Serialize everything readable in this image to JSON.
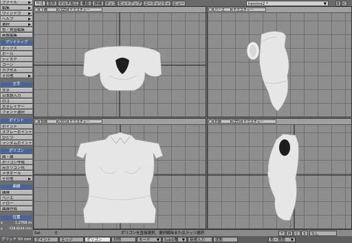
{
  "left_panel": {
    "file": "ファイル",
    "edit": "編集",
    "window": "ウィンドウ",
    "help": "ヘルプ",
    "select": "選択",
    "color_edit": "色・質感編集",
    "image_edit": "画像編集",
    "primitive_header": "プリミティブ",
    "box": "ボックス",
    "ball": "ボール",
    "disc": "ディスク",
    "cone": "コーン",
    "capsule": "カプセル",
    "other1": "その他",
    "text_header": "文字",
    "text": "文字",
    "jp_input": "日本語入力",
    "logo": "ロゴ",
    "text_layer": "文字レイヤー",
    "font_select": "フォント選択",
    "point_header": "ポイント",
    "point": "ポイント",
    "spray_point": "スプレーポイント",
    "bisect": "ひとつ",
    "random_point": "ランダムポイント",
    "polygon_header": "ポリゴン",
    "face": "面・曲",
    "make_polygon": "ポリゴン作成",
    "sketch": "点ポリゴン化",
    "metaball": "メタボール",
    "other2": "その他",
    "curve_header": "曲線",
    "curve": "曲線",
    "bezier": "ベジエ",
    "draw": "ドロー",
    "curve_make": "曲線作成",
    "position_header": "位置",
    "x_label": "x",
    "x_value": "1.2768 m",
    "y_label": "y",
    "y_value": "-158.8244 mm",
    "grid_label": "グリッド",
    "grid_value": "50 mm"
  },
  "top_tabs": [
    "作成",
    "変形",
    "マルチ加工",
    "構造",
    "詳細",
    "マップ",
    "セットアップ",
    "ユーティリティ",
    "ビュー"
  ],
  "top_right": {
    "object_name": "heroine2 *",
    "btn_e": "E",
    "btn_c": "C"
  },
  "viewports": {
    "top": {
      "name": "上面",
      "axis": "(XZ)",
      "mode": "テクスチャー"
    },
    "persp": {
      "name": "パース",
      "mode": "テクスチャー"
    },
    "back": {
      "name": "背面",
      "axis": "(XY)",
      "mode": "テクスチャー"
    },
    "right": {
      "name": "右面",
      "axis": "(ZY)",
      "mode": "テクスチャー"
    }
  },
  "status": {
    "sel_label": "Sel:",
    "sel_value": "0",
    "message": "ポリゴンを直接選択、選択解除またはラッソ選択",
    "right_buttons": [
      "T",
      "M",
      "C",
      "S"
    ],
    "undo": "なし"
  },
  "bottom_bar": {
    "point": "ポイント",
    "edge": "エッジ",
    "polygon": "ポリゴン",
    "symmetry": "対称",
    "mode": "モード",
    "subd": "SubD種",
    "new_input": "新規入力",
    "state": "状態",
    "color": "色・質感"
  }
}
